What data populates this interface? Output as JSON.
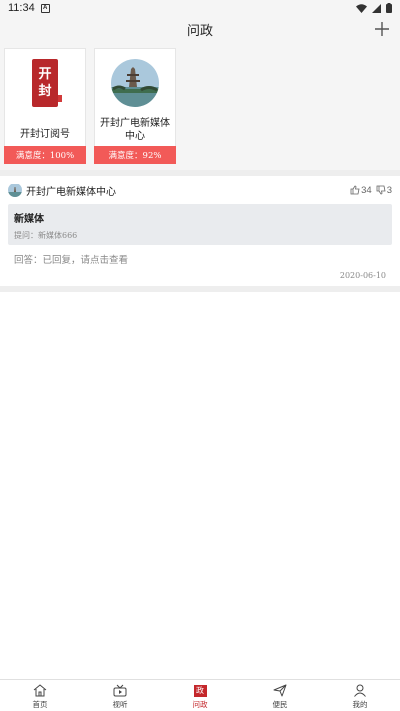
{
  "status_bar": {
    "time": "11:34",
    "notif_glyph": "A"
  },
  "header": {
    "title": "问政"
  },
  "cards": [
    {
      "label": "开封订阅号",
      "satisfaction": "满意度：100%",
      "logo_chars": [
        "开",
        "封"
      ]
    },
    {
      "label": "开封广电新媒体中心",
      "satisfaction": "满意度：92%"
    }
  ],
  "post": {
    "org": "开封广电新媒体中心",
    "likes": "34",
    "dislikes": "3",
    "question_title": "新媒体",
    "asker": "提问：新媒体666",
    "answer": "回答：已回复，请点击查看",
    "date": "2020-06-10"
  },
  "tabs": [
    {
      "label": "首页",
      "icon": "home-icon"
    },
    {
      "label": "视听",
      "icon": "tv-icon"
    },
    {
      "label": "问政",
      "icon": "zheng-icon",
      "icon_text": "政",
      "active": true
    },
    {
      "label": "便民",
      "icon": "send-icon"
    },
    {
      "label": "我的",
      "icon": "user-icon"
    }
  ],
  "colors": {
    "accent": "#c4272b",
    "satisfaction_bar": "#f25a58",
    "question_bg": "#e9ebee"
  }
}
